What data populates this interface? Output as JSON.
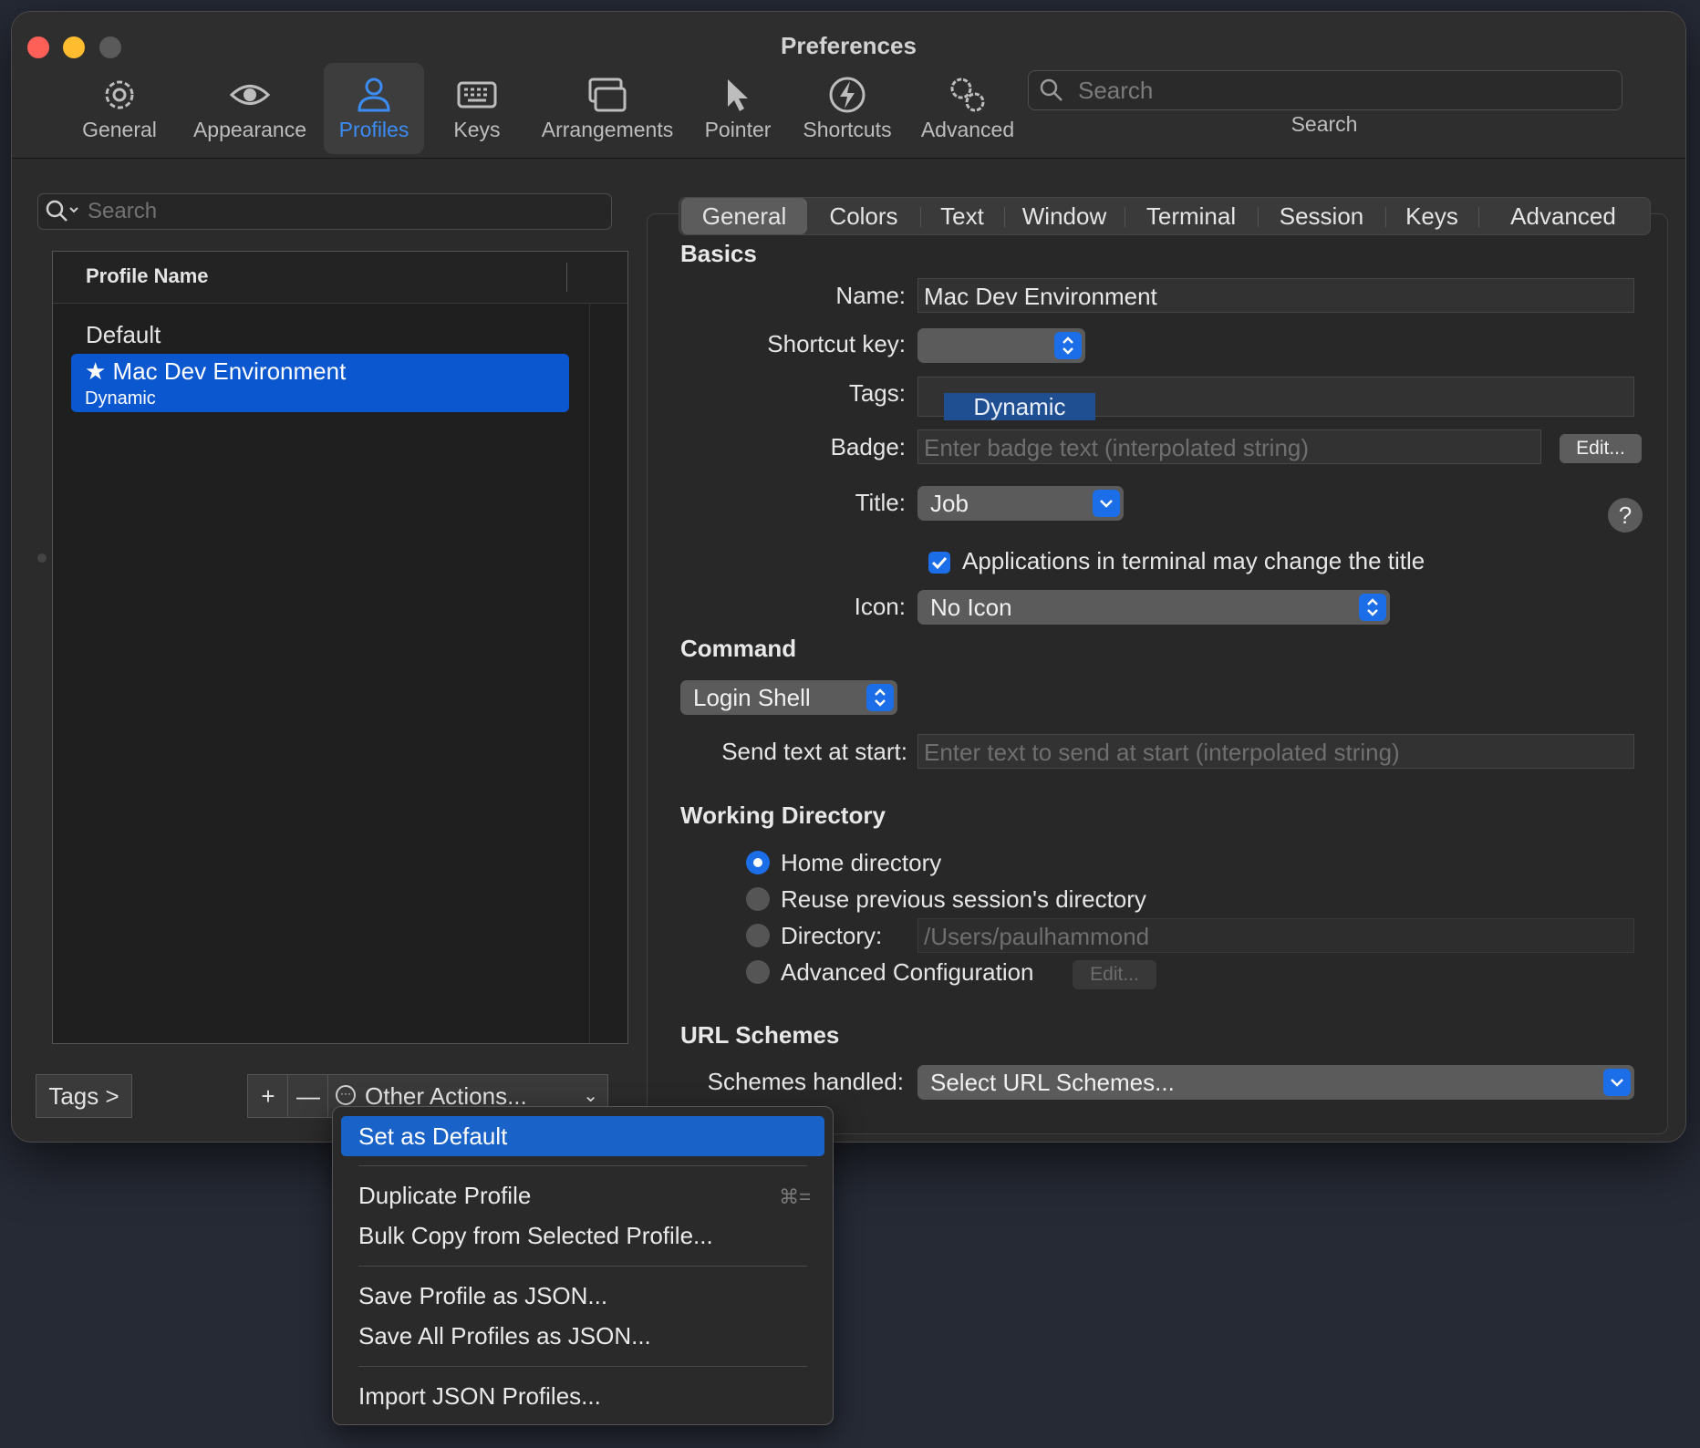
{
  "window": {
    "title": "Preferences"
  },
  "toolbar": {
    "items": [
      {
        "label": "General",
        "icon": "gear-icon"
      },
      {
        "label": "Appearance",
        "icon": "eye-icon"
      },
      {
        "label": "Profiles",
        "icon": "person-icon"
      },
      {
        "label": "Keys",
        "icon": "keyboard-icon"
      },
      {
        "label": "Arrangements",
        "icon": "windows-icon"
      },
      {
        "label": "Pointer",
        "icon": "pointer-icon"
      },
      {
        "label": "Shortcuts",
        "icon": "lightning-icon"
      },
      {
        "label": "Advanced",
        "icon": "gears-icon"
      }
    ],
    "active": "Profiles",
    "search_placeholder": "Search",
    "search_label": "Search"
  },
  "profiles": {
    "search_placeholder": "Search",
    "column_header": "Profile Name",
    "list": [
      {
        "name": "Default",
        "tag": ""
      },
      {
        "name": "Mac Dev Environment",
        "tag": "Dynamic",
        "selected": true
      }
    ],
    "tags_button": "Tags >",
    "add_button": "+",
    "remove_button": "—",
    "other_actions": "Other Actions..."
  },
  "tabs": [
    "General",
    "Colors",
    "Text",
    "Window",
    "Terminal",
    "Session",
    "Keys",
    "Advanced"
  ],
  "active_tab": "General",
  "general": {
    "basics_heading": "Basics",
    "name_label": "Name:",
    "name_value": "Mac Dev Environment",
    "shortcut_label": "Shortcut key:",
    "tags_label": "Tags:",
    "tags_value": "Dynamic",
    "badge_label": "Badge:",
    "badge_placeholder": "Enter badge text (interpolated string)",
    "badge_edit": "Edit...",
    "title_label": "Title:",
    "title_value": "Job",
    "help": "?",
    "title_checkbox": "Applications in terminal may change the title",
    "icon_label": "Icon:",
    "icon_value": "No Icon",
    "command_heading": "Command",
    "command_value": "Login Shell",
    "send_text_label": "Send text at start:",
    "send_text_placeholder": "Enter text to send at start (interpolated string)",
    "workdir_heading": "Working Directory",
    "workdir_options": [
      "Home directory",
      "Reuse previous session's directory",
      "Directory:",
      "Advanced Configuration"
    ],
    "workdir_selected": "Home directory",
    "directory_placeholder": "/Users/paulhammond",
    "advanced_edit": "Edit...",
    "url_heading": "URL Schemes",
    "schemes_label": "Schemes handled:",
    "schemes_value": "Select URL Schemes..."
  },
  "menu": {
    "items": [
      {
        "label": "Set as Default",
        "highlighted": true
      },
      {
        "label": "Duplicate Profile",
        "shortcut": "⌘="
      },
      {
        "label": "Bulk Copy from Selected Profile..."
      },
      {
        "label": "Save Profile as JSON..."
      },
      {
        "label": "Save All Profiles as JSON..."
      },
      {
        "label": "Import JSON Profiles..."
      }
    ]
  },
  "colors": {
    "accent": "#1b6ee8",
    "selection": "#0a57d0",
    "menu_highlight": "#1962c8"
  }
}
